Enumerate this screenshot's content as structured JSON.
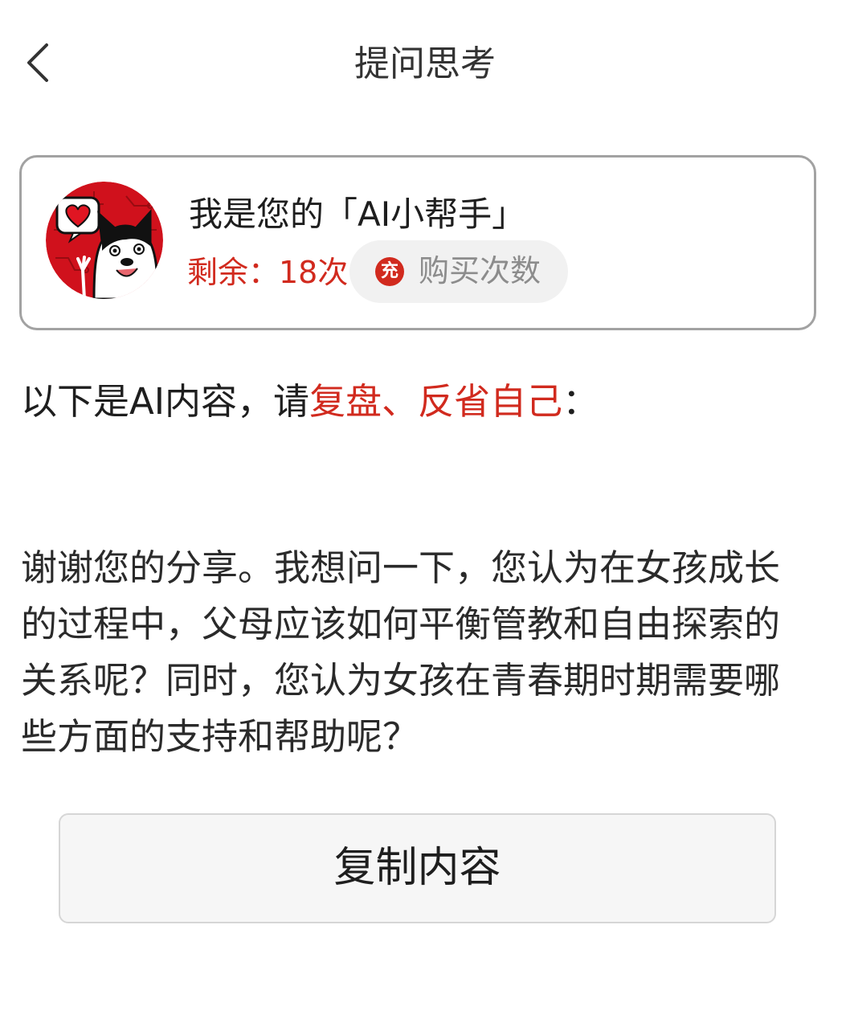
{
  "header": {
    "title": "提问思考",
    "back_icon": "chevron-left-icon"
  },
  "assistant_card": {
    "name": "我是您的「AI小帮手」",
    "remaining": "剩余：18次",
    "buy_button": {
      "icon_text": "充",
      "label": "购买次数"
    },
    "avatar_icon": "cartoon-dog-avatar"
  },
  "intro": {
    "prefix": "以下是AI内容，请",
    "highlight": "复盘、反省自己",
    "suffix": "："
  },
  "ai_content": "谢谢您的分享。我想问一下，您认为在女孩成长的过程中，父母应该如何平衡管教和自由探索的关系呢？同时，您认为女孩在青春期时期需要哪些方面的支持和帮助呢？",
  "copy_button": {
    "label": "复制内容"
  },
  "colors": {
    "accent_red": "#d12a1e",
    "card_border": "#a2a2a2",
    "button_bg": "#f6f6f6"
  }
}
